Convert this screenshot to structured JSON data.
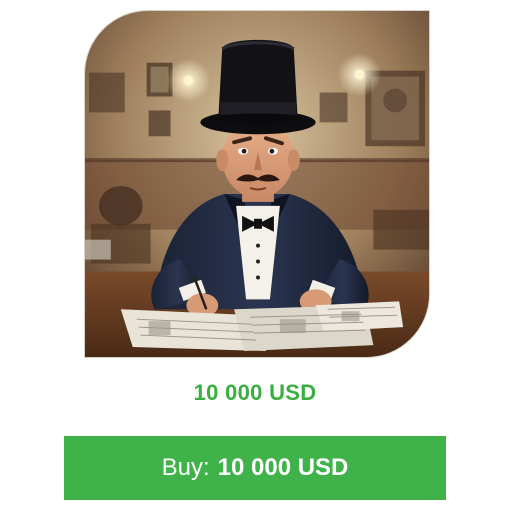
{
  "product": {
    "image_alt": "Man in top hat reading newspapers",
    "price": "10 000 USD"
  },
  "buy_button": {
    "prefix": "Buy:",
    "amount": "10 000 USD"
  },
  "colors": {
    "accent_green": "#3aae3f",
    "button_green": "#3fb34a"
  }
}
